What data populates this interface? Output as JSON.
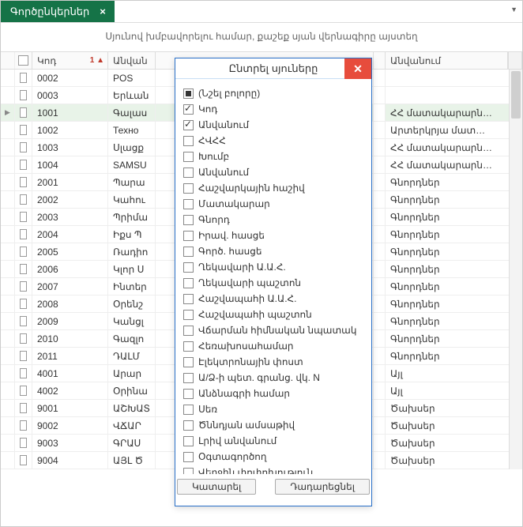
{
  "tab": {
    "title": "Գործընկերներ"
  },
  "hint": "Սյունով խմբավորելու համար, քաշեք սյան վերնագիրը այստեղ",
  "headers": {
    "code": "Կոդ",
    "name_short": "Անվան",
    "last": "Անվանում",
    "sort_indicator": "1 ▲"
  },
  "rows": [
    {
      "ind": "",
      "code": "0002",
      "name": "POS",
      "last": ""
    },
    {
      "ind": "",
      "code": "0003",
      "name": "Երևան",
      "last": ""
    },
    {
      "ind": "▶",
      "code": "1001",
      "name": "Գալաս",
      "last": "ՀՀ մատակարարն…",
      "selected": true
    },
    {
      "ind": "",
      "code": "1002",
      "name": "Техно",
      "last": "Արտերկրյա մատ…"
    },
    {
      "ind": "",
      "code": "1003",
      "name": "Սլացք",
      "last": "ՀՀ մատակարարն…"
    },
    {
      "ind": "",
      "code": "1004",
      "name": "SAMSU",
      "last": "ՀՀ մատակարարն…"
    },
    {
      "ind": "",
      "code": "2001",
      "name": "Պարա",
      "last": "Գնորդներ"
    },
    {
      "ind": "",
      "code": "2002",
      "name": "Կահու",
      "last": "Գնորդներ"
    },
    {
      "ind": "",
      "code": "2003",
      "name": "Պրիմա",
      "last": "Գնորդներ"
    },
    {
      "ind": "",
      "code": "2004",
      "name": "Իքս Պ",
      "last": "Գնորդներ"
    },
    {
      "ind": "",
      "code": "2005",
      "name": "Ռադիո",
      "last": "Գնորդներ"
    },
    {
      "ind": "",
      "code": "2006",
      "name": "Կլոր Ս",
      "last": "Գնորդներ"
    },
    {
      "ind": "",
      "code": "2007",
      "name": "Ինտեր",
      "last": "Գնորդներ"
    },
    {
      "ind": "",
      "code": "2008",
      "name": "Օրենշ",
      "last": "Գնորդներ"
    },
    {
      "ind": "",
      "code": "2009",
      "name": "Կանցլ",
      "last": "Գնորդներ"
    },
    {
      "ind": "",
      "code": "2010",
      "name": "Գազլո",
      "last": "Գնորդներ"
    },
    {
      "ind": "",
      "code": "2011",
      "name": "ԴԱԼՄ",
      "last": "Գնորդներ"
    },
    {
      "ind": "",
      "code": "4001",
      "name": "Արար",
      "last": "Այլ"
    },
    {
      "ind": "",
      "code": "4002",
      "name": "Օրինա",
      "last": "Այլ"
    },
    {
      "ind": "",
      "code": "9001",
      "name": "ԱՇԽԱՏ",
      "last": "Ծախսեր"
    },
    {
      "ind": "",
      "code": "9002",
      "name": "ՎՃԱՐ",
      "last": "Ծախսեր"
    },
    {
      "ind": "",
      "code": "9003",
      "name": "ԳՐԱՍ",
      "last": "Ծախսեր"
    },
    {
      "ind": "",
      "code": "9004",
      "name": "ԱՅԼ Ծ",
      "last": "Ծախսեր"
    }
  ],
  "dialog": {
    "title": "Ընտրել սյուները",
    "do": "Կատարել",
    "cancel": "Դադարեցնել",
    "options": [
      {
        "label": "(Նշել բոլորը)",
        "state": "mixed"
      },
      {
        "label": "Կոդ",
        "state": "checked"
      },
      {
        "label": "Անվանում",
        "state": "checked"
      },
      {
        "label": "ՀՎՀՀ",
        "state": ""
      },
      {
        "label": "Խումբ",
        "state": ""
      },
      {
        "label": "Անվանում",
        "state": ""
      },
      {
        "label": "Հաշվարկային հաշիվ",
        "state": ""
      },
      {
        "label": "Մատակարար",
        "state": ""
      },
      {
        "label": "Գնորդ",
        "state": ""
      },
      {
        "label": "Իրավ. հասցե",
        "state": ""
      },
      {
        "label": "Գործ. հասցե",
        "state": ""
      },
      {
        "label": "Ղեկավարի Ա.Ա.Հ.",
        "state": ""
      },
      {
        "label": "Ղեկավարի պաշտոն",
        "state": ""
      },
      {
        "label": "Հաշվապահի Ա.Ա.Հ.",
        "state": ""
      },
      {
        "label": "Հաշվապահի պաշտոն",
        "state": ""
      },
      {
        "label": "Վճարման հիմնական նպատակ",
        "state": ""
      },
      {
        "label": "Հեռախոսահամար",
        "state": ""
      },
      {
        "label": "Էլեկտրոնային փոստ",
        "state": ""
      },
      {
        "label": "Ա/Ձ-ի պետ. գրանց. վկ. N",
        "state": ""
      },
      {
        "label": "Անձնագրի համար",
        "state": ""
      },
      {
        "label": "Սեռ",
        "state": ""
      },
      {
        "label": "Ծննդյան ամսաթիվ",
        "state": ""
      },
      {
        "label": "Լրիվ անվանում",
        "state": ""
      },
      {
        "label": "Օգտագործող",
        "state": ""
      },
      {
        "label": "Վերջին փոփոխություն",
        "state": ""
      }
    ]
  }
}
